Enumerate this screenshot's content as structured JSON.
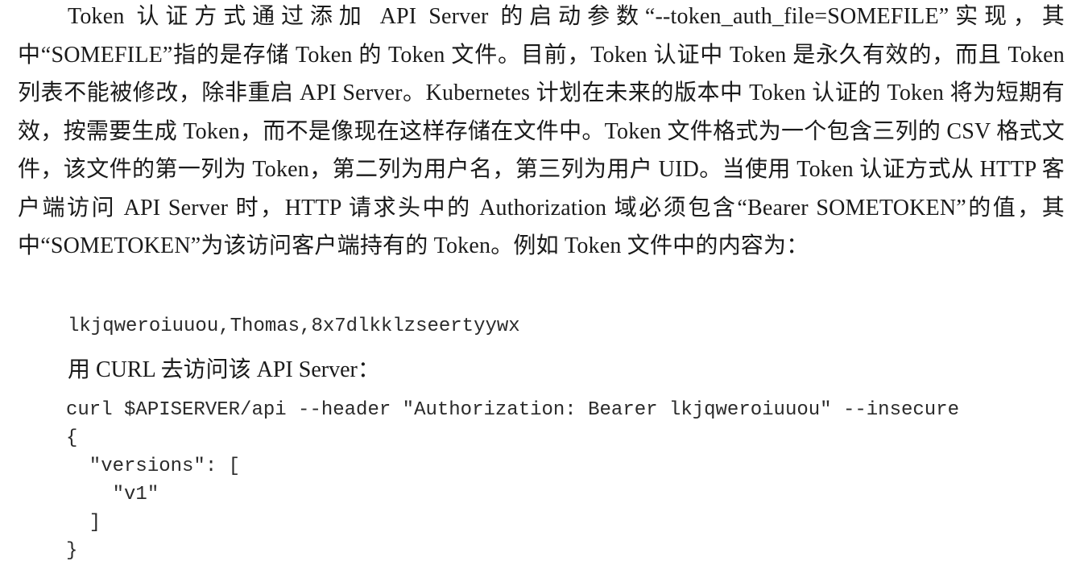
{
  "paragraph": "Token 认证方式通过添加 API Server 的启动参数“--token_auth_file=SOMEFILE”实现，其中“SOMEFILE”指的是存储 Token 的 Token 文件。目前，Token 认证中 Token 是永久有效的，而且 Token 列表不能被修改，除非重启 API Server。Kubernetes 计划在未来的版本中 Token 认证的 Token 将为短期有效，按需要生成 Token，而不是像现在这样存储在文件中。Token 文件格式为一个包含三列的 CSV 格式文件，该文件的第一列为 Token，第二列为用户名，第三列为用户 UID。当使用 Token 认证方式从 HTTP 客户端访问 API Server 时，HTTP 请求头中的 Authorization 域必须包含“Bearer SOMETOKEN”的值，其中“SOMETOKEN”为该访问客户端持有的 Token。例如 Token 文件中的内容为：",
  "csv_example": "lkjqweroiuuou,Thomas,8x7dlkklzseertyywx",
  "caption": "用 CURL 去访问该 API Server：",
  "code_block": "curl $APISERVER/api --header \"Authorization: Bearer lkjqweroiuuou\" --insecure\n{\n  \"versions\": [\n    \"v1\"\n  ]\n}"
}
